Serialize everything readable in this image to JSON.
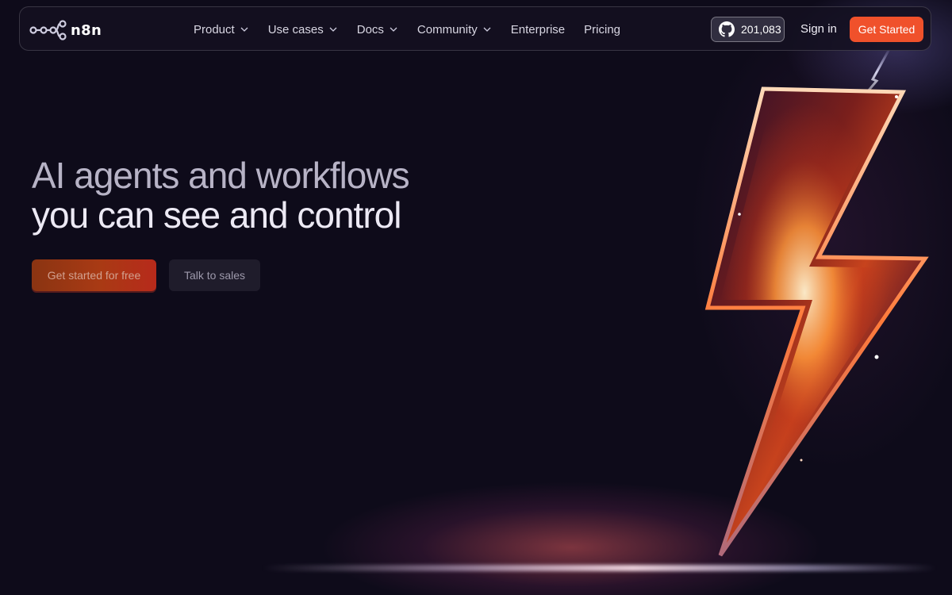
{
  "nav": {
    "brand": "n8n",
    "items": [
      {
        "label": "Product",
        "has_dropdown": true
      },
      {
        "label": "Use cases",
        "has_dropdown": true
      },
      {
        "label": "Docs",
        "has_dropdown": true
      },
      {
        "label": "Community",
        "has_dropdown": true
      },
      {
        "label": "Enterprise",
        "has_dropdown": false
      },
      {
        "label": "Pricing",
        "has_dropdown": false
      }
    ],
    "github_stars": "201,083",
    "sign_in": "Sign in",
    "get_started": "Get Started"
  },
  "hero": {
    "title_line1": "AI agents and workflows",
    "title_line2": "you can see and control",
    "primary_cta": "Get started for free",
    "secondary_cta": "Talk to sales"
  },
  "colors": {
    "background": "#0e0b1a",
    "accent": "#f0512b",
    "nav_text": "#d8d6e2"
  },
  "icons": [
    "n8n-logo-icon",
    "chevron-down-icon",
    "github-icon",
    "lightning-bolt-illustration"
  ]
}
